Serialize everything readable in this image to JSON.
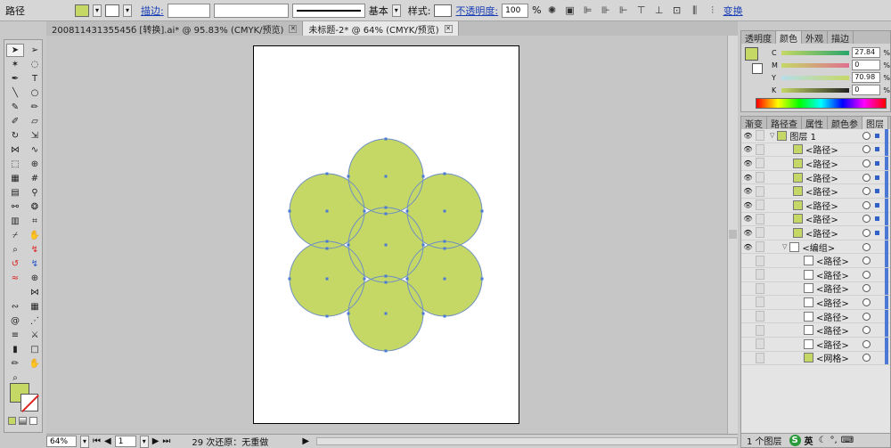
{
  "control_bar": {
    "object_type": "路径",
    "stroke_label": "描边:",
    "stroke_profile": "基本",
    "style_label": "样式:",
    "opacity_label": "不透明度:",
    "opacity_value": "100",
    "percent": "%",
    "transform_label": "变换"
  },
  "colors": {
    "fill": "#c5d866",
    "selection": "#4a78d4",
    "circle_stroke": "#6d8fc3"
  },
  "doc_tabs": [
    {
      "label": "20081143135545б [转换].ai* @ 95.83% (CMYK/预览)"
    },
    {
      "label": "未标题-2* @ 64% (CMYK/预览)"
    }
  ],
  "color_panel": {
    "tabs": [
      "透明度",
      "颜色",
      "外观",
      "描边"
    ],
    "channels": [
      {
        "name": "C",
        "value": "27.84"
      },
      {
        "name": "M",
        "value": "0"
      },
      {
        "name": "Y",
        "value": "70.98"
      },
      {
        "name": "K",
        "value": "0"
      }
    ],
    "unit": "%"
  },
  "layers_panel": {
    "tabs": [
      "渐变",
      "路径查",
      "属性",
      "颜色参",
      "图层"
    ],
    "rows": [
      {
        "label": "图层 1",
        "type": "layer"
      },
      {
        "label": "<路径>",
        "type": "path"
      },
      {
        "label": "<路径>",
        "type": "path"
      },
      {
        "label": "<路径>",
        "type": "path"
      },
      {
        "label": "<路径>",
        "type": "path"
      },
      {
        "label": "<路径>",
        "type": "path"
      },
      {
        "label": "<路径>",
        "type": "path"
      },
      {
        "label": "<路径>",
        "type": "path"
      },
      {
        "label": "<编组>",
        "type": "group"
      },
      {
        "label": "<路径>",
        "type": "subpath"
      },
      {
        "label": "<路径>",
        "type": "subpath"
      },
      {
        "label": "<路径>",
        "type": "subpath"
      },
      {
        "label": "<路径>",
        "type": "subpath"
      },
      {
        "label": "<路径>",
        "type": "subpath"
      },
      {
        "label": "<路径>",
        "type": "subpath"
      },
      {
        "label": "<路径>",
        "type": "subpath"
      },
      {
        "label": "<网格>",
        "type": "mesh"
      }
    ],
    "footer": "1 个图层"
  },
  "status_bar": {
    "zoom": "64%",
    "page": "1",
    "undo_text": "29 次还原：无重做"
  },
  "ime": {
    "logo": "S",
    "lang": "英"
  }
}
